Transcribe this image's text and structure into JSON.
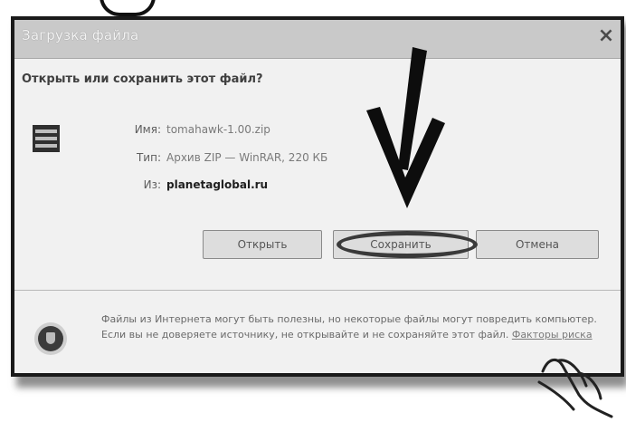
{
  "dialog": {
    "title": "Загрузка файла",
    "close_glyph": "×",
    "question": "Открыть или сохранить этот файл?",
    "file": {
      "name_label": "Имя:",
      "name_value": "tomahawk-1.00.zip",
      "type_label": "Тип:",
      "type_value": "Архив ZIP — WinRAR, 220 КБ",
      "from_label": "Из:",
      "from_value": "planetaglobal.ru"
    },
    "buttons": {
      "open": "Открыть",
      "save": "Сохранить",
      "cancel": "Отмена"
    },
    "warning": {
      "text": "Файлы из Интернета могут быть полезны, но некоторые файлы могут повредить компьютер. Если вы не доверяете источнику, не открывайте и не сохраняйте этот файл.",
      "link": "Факторы риска"
    }
  },
  "icons": [
    "file-archive-icon",
    "security-shield-icon",
    "close-icon"
  ],
  "annotations": [
    "down-arrow-annotation",
    "save-ring-annotation",
    "pointer-hand-annotation"
  ],
  "colors": {
    "frame": "#1a1a1a",
    "dialog_bg": "#f1f1f1",
    "titlebar": "#c9c9c9"
  }
}
